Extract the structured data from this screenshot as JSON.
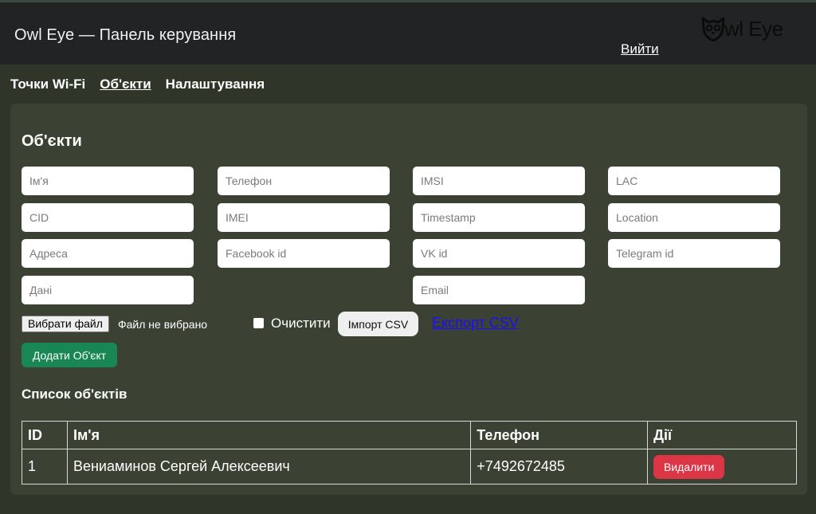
{
  "header": {
    "title": "Owl Eye — Панель керування",
    "logout_label": "Вийти",
    "logo_text": "wl Eye",
    "logo_icon": "owl-icon"
  },
  "nav": {
    "items": [
      {
        "label": "Точки Wi-Fi",
        "active": false
      },
      {
        "label": "Об'єкти",
        "active": true
      },
      {
        "label": "Налаштування",
        "active": false
      }
    ]
  },
  "form": {
    "title": "Об'єкти",
    "placeholders": {
      "name": "Ім'я",
      "phone": "Телефон",
      "imsi": "IMSI",
      "lac": "LAC",
      "cid": "CID",
      "imei": "IMEI",
      "timestamp": "Timestamp",
      "location": "Location",
      "address": "Адреса",
      "facebook": "Facebook id",
      "vk": "VK id",
      "telegram": "Telegram id",
      "data": "Дані",
      "email": "Email"
    },
    "file_button_label": "Вибрати файл",
    "file_status": "Файл не вибрано",
    "clear_label": "Очистити",
    "import_label": "Імпорт CSV",
    "export_label": "Експорт CSV",
    "add_label": "Додати Об'єкт"
  },
  "list": {
    "title": "Список об'єктів",
    "columns": [
      "ID",
      "Ім'я",
      "Телефон",
      "Дії"
    ],
    "rows": [
      {
        "id": "1",
        "name": "Вениаминов Сергей Алексеевич",
        "phone": "+7492672485",
        "action_label": "Видалити"
      }
    ]
  },
  "colors": {
    "background": "#2f3528",
    "panel": "#3c4233",
    "topbar": "#222324",
    "add_button": "#198754",
    "delete_button": "#dc3545",
    "export_link": "#1a0dff"
  }
}
